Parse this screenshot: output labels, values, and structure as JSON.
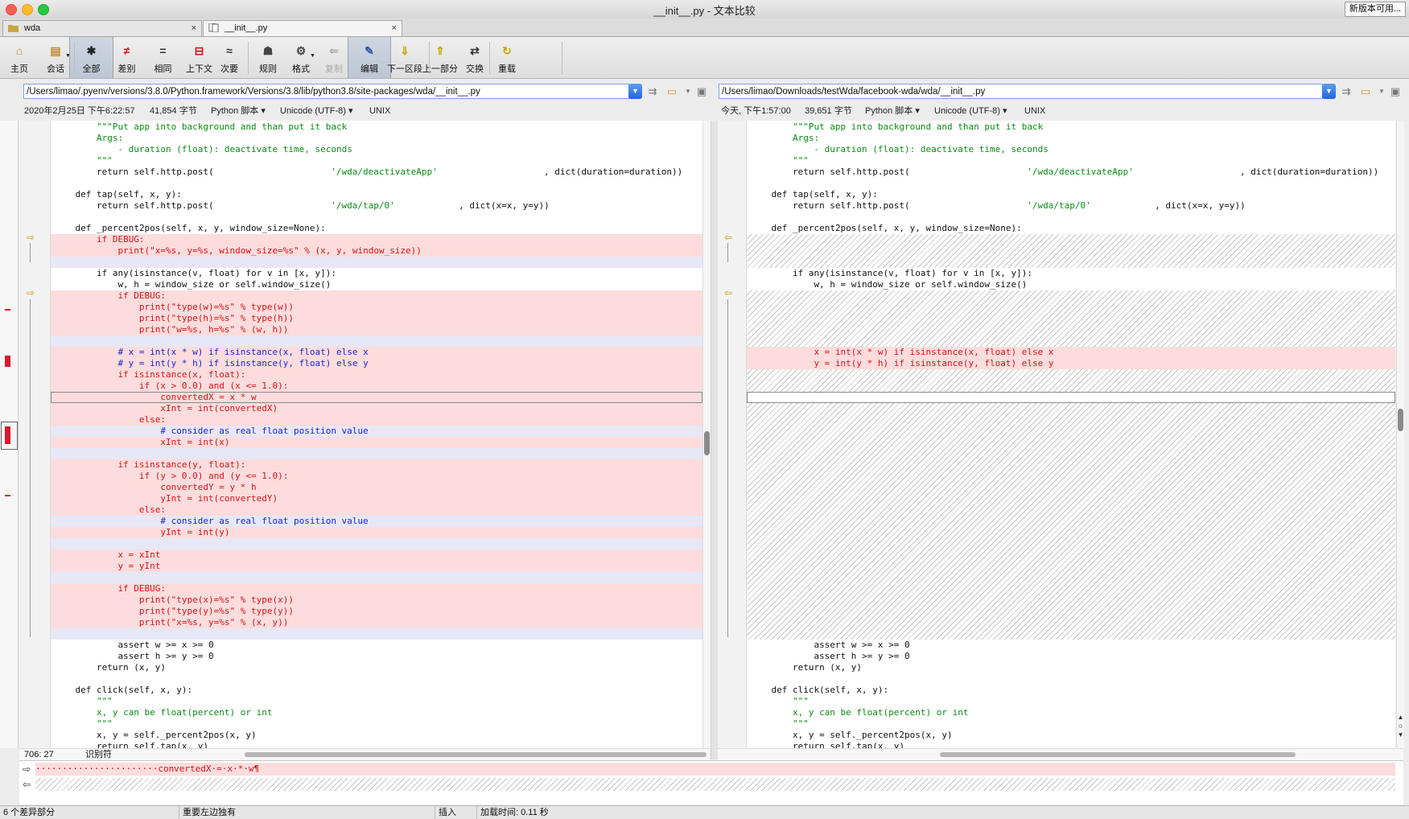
{
  "window": {
    "title": "__init__.py - 文本比较",
    "update_button": "新版本可用..."
  },
  "tabs": [
    {
      "label": "wda",
      "close": "×"
    },
    {
      "label": "__init__.py",
      "close": "×"
    }
  ],
  "toolbar": [
    {
      "label": "主页",
      "icon": "home-icon",
      "glyph": "⌂"
    },
    {
      "label": "会话",
      "icon": "session-icon",
      "glyph": "▤"
    },
    {
      "label": "全部",
      "icon": "all-icon",
      "glyph": "✱"
    },
    {
      "label": "差别",
      "icon": "diff-icon",
      "glyph": "≠"
    },
    {
      "label": "相同",
      "icon": "same-icon",
      "glyph": "="
    },
    {
      "label": "上下文",
      "icon": "context-icon",
      "glyph": "⊟"
    },
    {
      "label": "次要",
      "icon": "minor-icon",
      "glyph": "≈"
    },
    {
      "label": "规则",
      "icon": "rules-icon",
      "glyph": "☗"
    },
    {
      "label": "格式",
      "icon": "format-icon",
      "glyph": "⚙"
    },
    {
      "label": "复制",
      "icon": "copy-icon",
      "glyph": "⇐"
    },
    {
      "label": "编辑",
      "icon": "edit-icon",
      "glyph": "✎"
    },
    {
      "label": "下一区段",
      "icon": "next-section-icon",
      "glyph": "⇓"
    },
    {
      "label": "上一部分",
      "icon": "prev-section-icon",
      "glyph": "⇑"
    },
    {
      "label": "交换",
      "icon": "swap-icon",
      "glyph": "⇄"
    },
    {
      "label": "重载",
      "icon": "reload-icon",
      "glyph": "↻"
    }
  ],
  "left": {
    "path": "/Users/limao/.pyenv/versions/3.8.0/Python.framework/Versions/3.8/lib/python3.8/site-packages/wda/__init__.py",
    "date": "2020年2月25日 下午6:22:57",
    "size": "41,854 字节",
    "format": "Python 脚本",
    "encoding": "Unicode (UTF-8)",
    "line_endings": "UNIX",
    "cursor_pos": "706: 27",
    "mode": "识别符",
    "lines": [
      {
        "i": 0,
        "t": [
          {
            "x": 4,
            "s": "\"\"\"Put app into background and than put it back",
            "c": "str"
          }
        ]
      },
      {
        "i": 1,
        "t": [
          {
            "x": 4,
            "s": "Args:",
            "c": "str"
          }
        ]
      },
      {
        "i": 2,
        "t": [
          {
            "x": 6,
            "s": "- duration (float): deactivate time, seconds",
            "c": "str"
          }
        ]
      },
      {
        "i": 3,
        "t": [
          {
            "x": 4,
            "s": "\"\"\"",
            "c": "str"
          }
        ]
      },
      {
        "i": 4,
        "t": [
          {
            "x": 4,
            "s": "return self.http.post("
          },
          {
            "x": 26,
            "s": "'/wda/deactivateApp'",
            "c": "str"
          },
          {
            "x": 46,
            "s": ", dict(duration=duration))"
          }
        ]
      },
      {
        "i": 6,
        "t": [
          {
            "x": 2,
            "s": "def tap(self, x, y):"
          }
        ]
      },
      {
        "i": 7,
        "t": [
          {
            "x": 4,
            "s": "return self.http.post("
          },
          {
            "x": 26,
            "s": "'/wda/tap/0'",
            "c": "str"
          },
          {
            "x": 38,
            "s": ", dict(x=x, y=y))"
          }
        ]
      },
      {
        "i": 9,
        "t": [
          {
            "x": 2,
            "s": "def _percent2pos(self, x, y, window_size=None):"
          }
        ]
      },
      {
        "i": 10,
        "k": "diff",
        "t": [
          {
            "x": 4,
            "s": "if DEBUG:"
          }
        ]
      },
      {
        "i": 11,
        "k": "diff",
        "t": [
          {
            "x": 6,
            "s": "print(\"x=%s, y=%s, window_size=%s\" % (x, y, window_size))"
          }
        ]
      },
      {
        "i": 12,
        "k": "gap",
        "t": []
      },
      {
        "i": 13,
        "t": [
          {
            "x": 4,
            "s": "if any(isinstance(v, float) for v in [x, y]):"
          }
        ]
      },
      {
        "i": 14,
        "t": [
          {
            "x": 6,
            "s": "w, h = window_size or self.window_size()"
          }
        ]
      },
      {
        "i": 15,
        "k": "diff",
        "t": [
          {
            "x": 6,
            "s": "if DEBUG:"
          }
        ]
      },
      {
        "i": 16,
        "k": "diff",
        "t": [
          {
            "x": 8,
            "s": "print(\"type(w)=%s\" % type(w))"
          }
        ]
      },
      {
        "i": 17,
        "k": "diff",
        "t": [
          {
            "x": 8,
            "s": "print(\"type(h)=%s\" % type(h))"
          }
        ]
      },
      {
        "i": 18,
        "k": "diff",
        "t": [
          {
            "x": 8,
            "s": "print(\"w=%s, h=%s\" % (w, h))"
          }
        ]
      },
      {
        "i": 19,
        "k": "gap",
        "t": []
      },
      {
        "i": 20,
        "k": "diff",
        "t": [
          {
            "x": 6,
            "s": "# x = int(x * w) if isinstance(x, float) else x",
            "c": "cmt"
          }
        ]
      },
      {
        "i": 21,
        "k": "diff",
        "t": [
          {
            "x": 6,
            "s": "# y = int(y * h) if isinstance(y, float) else y",
            "c": "cmt"
          }
        ]
      },
      {
        "i": 22,
        "k": "diff",
        "t": [
          {
            "x": 6,
            "s": "if isinstance(x, float):"
          }
        ]
      },
      {
        "i": 23,
        "k": "diff",
        "t": [
          {
            "x": 8,
            "s": "if (x > 0.0) and (x <= 1.0):"
          }
        ]
      },
      {
        "i": 24,
        "k": "diff",
        "h": true,
        "t": [
          {
            "x": 10,
            "s": "convertedX = x * w"
          }
        ]
      },
      {
        "i": 25,
        "k": "diff",
        "t": [
          {
            "x": 10,
            "s": "xInt = int(convertedX)"
          }
        ]
      },
      {
        "i": 26,
        "k": "diff",
        "t": [
          {
            "x": 8,
            "s": "else:"
          }
        ]
      },
      {
        "i": 27,
        "k": "gap",
        "t": [
          {
            "x": 10,
            "s": "# consider as real float position value",
            "c": "cmt"
          }
        ]
      },
      {
        "i": 28,
        "k": "diff",
        "t": [
          {
            "x": 10,
            "s": "xInt = int(x)"
          }
        ]
      },
      {
        "i": 29,
        "k": "gap",
        "t": []
      },
      {
        "i": 30,
        "k": "diff",
        "t": [
          {
            "x": 6,
            "s": "if isinstance(y, float):"
          }
        ]
      },
      {
        "i": 31,
        "k": "diff",
        "t": [
          {
            "x": 8,
            "s": "if (y > 0.0) and (y <= 1.0):"
          }
        ]
      },
      {
        "i": 32,
        "k": "diff",
        "t": [
          {
            "x": 10,
            "s": "convertedY = y * h"
          }
        ]
      },
      {
        "i": 33,
        "k": "diff",
        "t": [
          {
            "x": 10,
            "s": "yInt = int(convertedY)"
          }
        ]
      },
      {
        "i": 34,
        "k": "diff",
        "t": [
          {
            "x": 8,
            "s": "else:"
          }
        ]
      },
      {
        "i": 35,
        "k": "gap",
        "t": [
          {
            "x": 10,
            "s": "# consider as real float position value",
            "c": "cmt"
          }
        ]
      },
      {
        "i": 36,
        "k": "diff",
        "t": [
          {
            "x": 10,
            "s": "yInt = int(y)"
          }
        ]
      },
      {
        "i": 37,
        "k": "gap",
        "t": []
      },
      {
        "i": 38,
        "k": "diff",
        "t": [
          {
            "x": 6,
            "s": "x = xInt"
          }
        ]
      },
      {
        "i": 39,
        "k": "diff",
        "t": [
          {
            "x": 6,
            "s": "y = yInt"
          }
        ]
      },
      {
        "i": 40,
        "k": "gap",
        "t": []
      },
      {
        "i": 41,
        "k": "diff",
        "t": [
          {
            "x": 6,
            "s": "if DEBUG:"
          }
        ]
      },
      {
        "i": 42,
        "k": "diff",
        "t": [
          {
            "x": 8,
            "s": "print(\"type(x)=%s\" % type(x))"
          }
        ]
      },
      {
        "i": 43,
        "k": "diff",
        "t": [
          {
            "x": 8,
            "s": "print(\"type(y)=%s\" % type(y))"
          }
        ]
      },
      {
        "i": 44,
        "k": "diff",
        "t": [
          {
            "x": 8,
            "s": "print(\"x=%s, y=%s\" % (x, y))"
          }
        ]
      },
      {
        "i": 45,
        "k": "gap",
        "t": []
      },
      {
        "i": 46,
        "t": [
          {
            "x": 6,
            "s": "assert w >= x >= 0"
          }
        ]
      },
      {
        "i": 47,
        "t": [
          {
            "x": 6,
            "s": "assert h >= y >= 0"
          }
        ]
      },
      {
        "i": 48,
        "t": [
          {
            "x": 4,
            "s": "return (x, y)"
          }
        ]
      },
      {
        "i": 50,
        "t": [
          {
            "x": 2,
            "s": "def click(self, x, y):"
          }
        ]
      },
      {
        "i": 51,
        "t": [
          {
            "x": 4,
            "s": "\"\"\"",
            "c": "str"
          }
        ]
      },
      {
        "i": 52,
        "t": [
          {
            "x": 4,
            "s": "x, y can be float(percent) or int",
            "c": "str"
          }
        ]
      },
      {
        "i": 53,
        "t": [
          {
            "x": 4,
            "s": "\"\"\"",
            "c": "str"
          }
        ]
      },
      {
        "i": 54,
        "t": [
          {
            "x": 4,
            "s": "x, y = self._percent2pos(x, y)"
          }
        ]
      },
      {
        "i": 55,
        "t": [
          {
            "x": 4,
            "s": "return self.tap(x, y)"
          }
        ]
      }
    ]
  },
  "right": {
    "path": "/Users/limao/Downloads/testWda/facebook-wda/wda/__init__.py",
    "date": "今天, 下午1:57:00",
    "size": "39,651 字节",
    "format": "Python 脚本",
    "encoding": "Unicode (UTF-8)",
    "line_endings": "UNIX",
    "lines": [
      {
        "i": 0,
        "t": [
          {
            "x": 4,
            "s": "\"\"\"Put app into background and than put it back",
            "c": "str"
          }
        ]
      },
      {
        "i": 1,
        "t": [
          {
            "x": 4,
            "s": "Args:",
            "c": "str"
          }
        ]
      },
      {
        "i": 2,
        "t": [
          {
            "x": 6,
            "s": "- duration (float): deactivate time, seconds",
            "c": "str"
          }
        ]
      },
      {
        "i": 3,
        "t": [
          {
            "x": 4,
            "s": "\"\"\"",
            "c": "str"
          }
        ]
      },
      {
        "i": 4,
        "t": [
          {
            "x": 4,
            "s": "return self.http.post("
          },
          {
            "x": 26,
            "s": "'/wda/deactivateApp'",
            "c": "str"
          },
          {
            "x": 46,
            "s": ", dict(duration=duration))"
          }
        ]
      },
      {
        "i": 6,
        "t": [
          {
            "x": 2,
            "s": "def tap(self, x, y):"
          }
        ]
      },
      {
        "i": 7,
        "t": [
          {
            "x": 4,
            "s": "return self.http.post("
          },
          {
            "x": 26,
            "s": "'/wda/tap/0'",
            "c": "str"
          },
          {
            "x": 38,
            "s": ", dict(x=x, y=y))"
          }
        ]
      },
      {
        "i": 9,
        "t": [
          {
            "x": 2,
            "s": "def _percent2pos(self, x, y, window_size=None):"
          }
        ]
      },
      {
        "i": 13,
        "t": [
          {
            "x": 4,
            "s": "if any(isinstance(v, float) for v in [x, y]):"
          }
        ]
      },
      {
        "i": 14,
        "t": [
          {
            "x": 6,
            "s": "w, h = window_size or self.window_size()"
          }
        ]
      },
      {
        "i": 20,
        "k": "diff",
        "t": [
          {
            "x": 6,
            "s": "x = int(x * w) if isinstance(x, float) else x"
          }
        ]
      },
      {
        "i": 21,
        "k": "diff",
        "t": [
          {
            "x": 6,
            "s": "y = int(y * h) if isinstance(y, float) else y"
          }
        ]
      },
      {
        "i": 24,
        "k": "empty",
        "h": true,
        "t": []
      },
      {
        "i": 46,
        "t": [
          {
            "x": 6,
            "s": "assert w >= x >= 0"
          }
        ]
      },
      {
        "i": 47,
        "t": [
          {
            "x": 6,
            "s": "assert h >= y >= 0"
          }
        ]
      },
      {
        "i": 48,
        "t": [
          {
            "x": 4,
            "s": "return (x, y)"
          }
        ]
      },
      {
        "i": 50,
        "t": [
          {
            "x": 2,
            "s": "def click(self, x, y):"
          }
        ]
      },
      {
        "i": 51,
        "t": [
          {
            "x": 4,
            "s": "\"\"\"",
            "c": "str"
          }
        ]
      },
      {
        "i": 52,
        "t": [
          {
            "x": 4,
            "s": "x, y can be float(percent) or int",
            "c": "str"
          }
        ]
      },
      {
        "i": 53,
        "t": [
          {
            "x": 4,
            "s": "\"\"\"",
            "c": "str"
          }
        ]
      },
      {
        "i": 54,
        "t": [
          {
            "x": 4,
            "s": "x, y = self._percent2pos(x, y)"
          }
        ]
      },
      {
        "i": 55,
        "t": [
          {
            "x": 4,
            "s": "return self.tap(x, y)"
          }
        ]
      }
    ],
    "hatched_ranges": [
      [
        10,
        12
      ],
      [
        15,
        19
      ],
      [
        22,
        23
      ],
      [
        25,
        45
      ]
    ]
  },
  "compare_line": {
    "left": "·······················convertedX·=·x·*·w¶",
    "right": ""
  },
  "status": {
    "diff_count": "6 个差异部分",
    "unimportant": "重要左边独有",
    "insert_mode": "插入",
    "load_time": "加载时间: 0.11 秒"
  },
  "colors": {
    "diff_bg": "#fcdcdc",
    "diff_text": "#d6141c",
    "string": "#0c8a16",
    "comment": "#1b25d6"
  }
}
